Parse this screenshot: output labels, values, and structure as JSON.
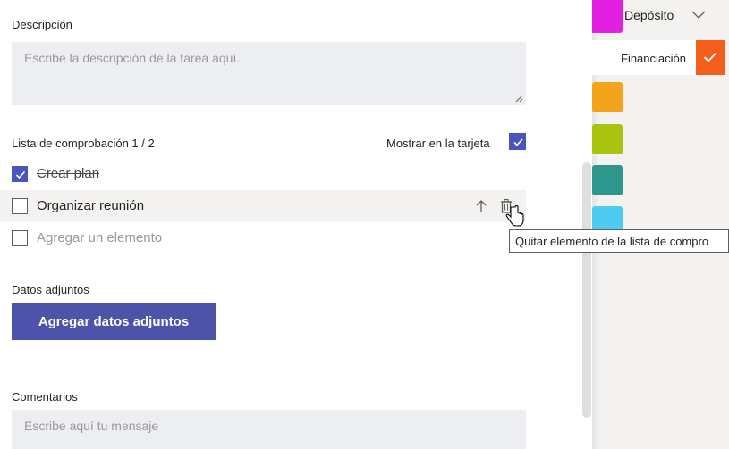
{
  "description": {
    "label": "Descripción",
    "placeholder": "Escribe la descripción de la tarea aquí."
  },
  "checklist": {
    "label": "Lista de comprobación 1 / 2",
    "show_on_card_label": "Mostrar en la tarjeta",
    "show_on_card_checked": true,
    "items": [
      {
        "text": "Crear plan",
        "checked": true
      },
      {
        "text": "Organizar reunión",
        "checked": false
      }
    ],
    "add_item_placeholder": "Agregar un elemento"
  },
  "attachments": {
    "label": "Datos adjuntos",
    "button_label": "Agregar datos adjuntos"
  },
  "comments": {
    "label": "Comentarios",
    "placeholder": "Escribe aquí tu mensaje"
  },
  "tooltip": "Quitar elemento de la lista de compro",
  "labels_pane": {
    "deposito": "Depósito",
    "financiacion": "Financiación",
    "colors": {
      "magenta": "#e31fe0",
      "orange_red": "#f55d1b",
      "orange": "#f3a41a",
      "lime": "#a8c40f",
      "teal": "#2e968d",
      "sky": "#4ecbf0"
    }
  },
  "accent_color": "#4b53bc",
  "icons": [
    "check-icon",
    "arrow-up-icon",
    "trash-icon",
    "hand-cursor-icon",
    "chevron-down-icon",
    "resize-grip-icon"
  ]
}
